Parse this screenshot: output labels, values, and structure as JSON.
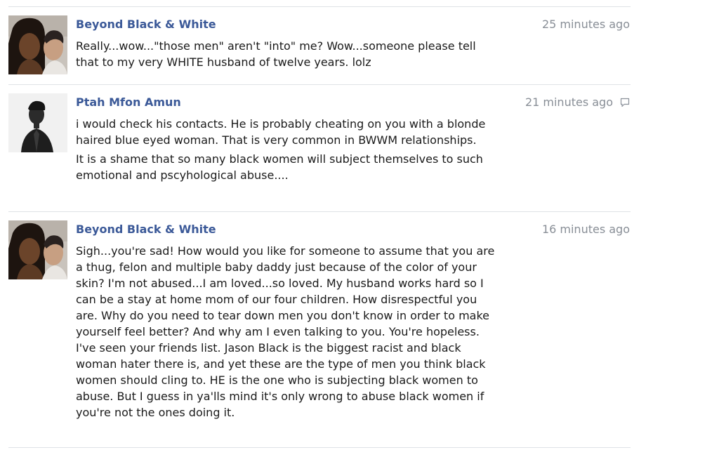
{
  "comments": [
    {
      "author": "Beyond Black & White",
      "time": "25 minutes ago",
      "paragraphs": [
        "Really...wow...\"those men\" aren't \"into\" me? Wow...someone please tell that to my very WHITE husband of twelve years. lolz"
      ]
    },
    {
      "author": "Ptah Mfon Amun",
      "time": "21 minutes ago",
      "reply_icon": "comment-bubble-icon",
      "paragraphs": [
        "i would check his contacts. He is probably cheating on you with a blonde haired blue eyed woman. That is very common in BWWM relationships.",
        "It is a shame that so many black women will subject themselves to such emotional and pscyhological abuse...."
      ]
    },
    {
      "author": "Beyond Black & White",
      "time": "16 minutes ago",
      "paragraphs": [
        "Sigh...you're sad! How would you like for someone to assume that you are a thug, felon and multiple baby daddy just because of the color of your skin? I'm not abused...I am loved...so loved. My husband works hard so I can be a stay at home mom of our four children. How disrespectful you are. Why do you need to tear down men you don't know in order to make yourself feel better? And why am I even talking to you. You're hopeless. I've seen your friends list. Jason Black is the biggest racist and black woman hater there is, and yet these are the type of men you think black women should cling to. HE is the one who is subjecting black women to abuse. But I guess in ya'lls mind it's only wrong to abuse black women if you're not the ones doing it."
      ]
    }
  ],
  "colors": {
    "link": "#3b5998",
    "timestamp": "#888e96",
    "divider": "#dfe2e6"
  }
}
